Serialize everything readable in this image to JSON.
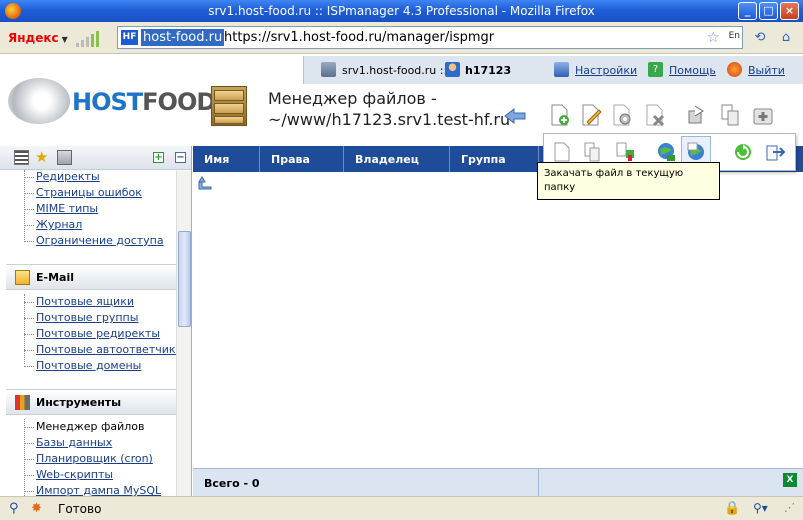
{
  "window": {
    "title": "srv1.host-food.ru :: ISPmanager 4.3 Professional - Mozilla Firefox"
  },
  "browser": {
    "search_engine": "Яндекс",
    "site_badge": "HF",
    "url_host": "host-food.ru",
    "url_full": "https://srv1.host-food.ru/manager/ispmgr",
    "lang": "En",
    "status": "Готово"
  },
  "header": {
    "server": "srv1.host-food.ru ::",
    "user": "h17123",
    "settings": "Настройки",
    "help": "Помощь",
    "logout": "Выйти"
  },
  "logo": {
    "part1": "HOST",
    "part2": "FOOD"
  },
  "page": {
    "title_line1": "Менеджер файлов -",
    "title_line2": "~/www/h17123.srv1.test-hf.ru"
  },
  "sidebar": {
    "group1": [
      "Редиректы",
      "Страницы ошибок",
      "MIME типы",
      "Журнал",
      "Ограничение доступа"
    ],
    "email_title": "E-Mail",
    "email_items": [
      "Почтовые ящики",
      "Почтовые группы",
      "Почтовые редиректы",
      "Почтовые автоответчики",
      "Почтовые домены"
    ],
    "tools_title": "Инструменты",
    "tools_items": [
      "Менеджер файлов",
      "Базы данных",
      "Планировщик (cron)",
      "Web-скрипты",
      "Импорт дампа MySQL"
    ]
  },
  "table": {
    "columns": [
      "Имя",
      "Права",
      "Владелец",
      "Группа"
    ],
    "total": "Всего - 0"
  },
  "tooltip": {
    "text": "Закачать файл в текущую папку"
  },
  "colors": {
    "header_blue": "#1f4c99",
    "link": "#1a3e8c",
    "tooltip_bg": "#ffffe1"
  }
}
